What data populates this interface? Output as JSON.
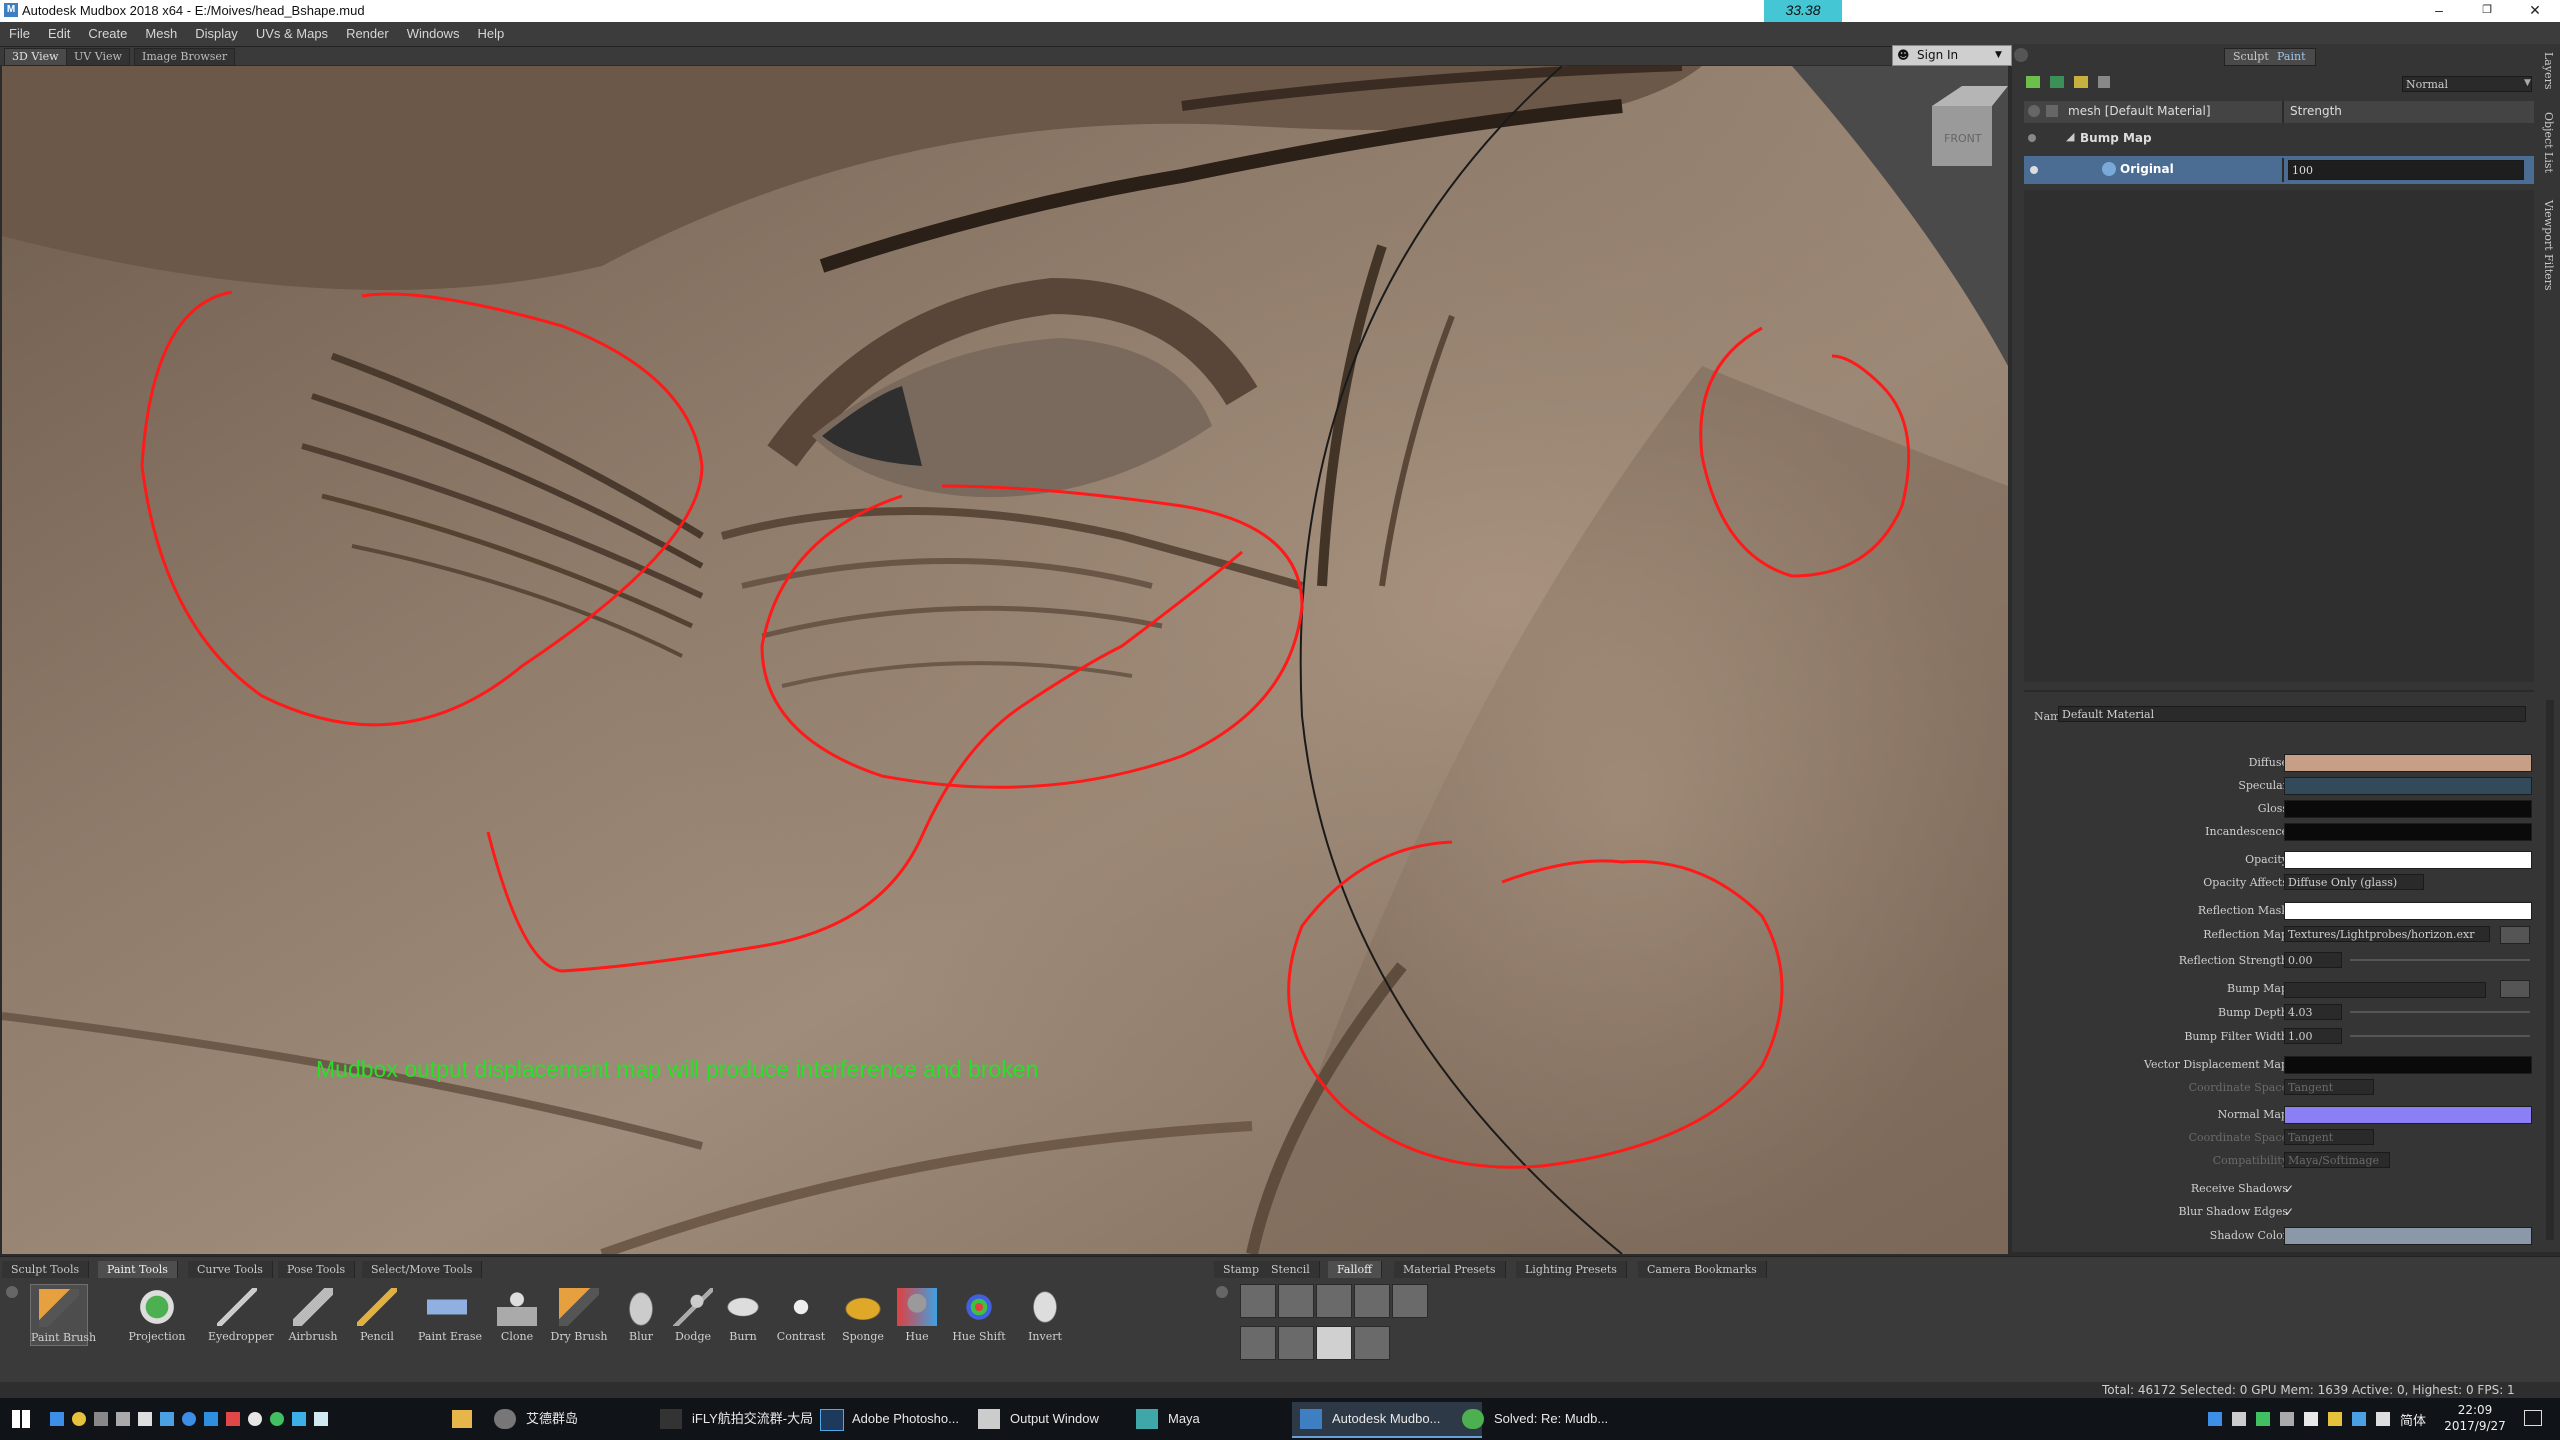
{
  "window": {
    "title": "Autodesk Mudbox 2018 x64 - E:/Moives/head_Bshape.mud",
    "fps_readout": "33.38",
    "minimize": "–",
    "restore": "❐",
    "close": "✕"
  },
  "menu": [
    "File",
    "Edit",
    "Create",
    "Mesh",
    "Display",
    "UVs & Maps",
    "Render",
    "Windows",
    "Help"
  ],
  "view_tabs": [
    "3D View",
    "UV View",
    "Image Browser"
  ],
  "signin": "Sign In",
  "viewcube_label": "FRONT",
  "annotation_text": "Mudbox output displacement map will produce interference and broken",
  "colors": {
    "annotation_red": "#ff1a1a",
    "annotation_green": "#28e028",
    "diffuse": "#c79f86",
    "specular": "#334a5a",
    "normal_map": "#8a7ff5",
    "shadow_color": "#8a98a8",
    "skin": "#7e6a5a"
  },
  "right_panel": {
    "mode_tabs": [
      "Sculpt",
      "Paint"
    ],
    "blend_mode": "Normal",
    "layer_header": {
      "name": "mesh [Default Material]",
      "strength": "Strength"
    },
    "group": "Bump Map",
    "layer": {
      "name": "Original",
      "value": "100"
    },
    "side_tabs": [
      "Layers",
      "Object List",
      "Viewport Filters"
    ],
    "material_name_label": "Name",
    "material_name": "Default Material",
    "props": {
      "diffuse": "Diffuse",
      "specular": "Specular",
      "gloss": "Gloss",
      "incandescence": "Incandescence",
      "opacity": "Opacity",
      "opacity_affects": "Opacity Affects",
      "opacity_affects_value": "Diffuse Only (glass)",
      "reflection_mask": "Reflection Mask",
      "reflection_map": "Reflection Map",
      "reflection_map_value": "Textures/Lightprobes/horizon.exr",
      "reflection_strength": "Reflection Strength",
      "reflection_strength_value": "0.00",
      "bump_map": "Bump Map",
      "bump_depth": "Bump Depth",
      "bump_depth_value": "4.03",
      "bump_filter_width": "Bump Filter Width",
      "bump_filter_width_value": "1.00",
      "vector_displacement_map": "Vector Displacement Map",
      "coordinate_space": "Coordinate Space",
      "coordinate_space_value": "Tangent",
      "normal_map": "Normal Map",
      "coordinate_space2": "Coordinate Space",
      "coordinate_space2_value": "Tangent",
      "compatibility": "Compatibility",
      "compatibility_value": "Maya/Softimage",
      "receive_shadows": "Receive Shadows",
      "blur_shadow_edges": "Blur Shadow Edges",
      "shadow_color": "Shadow Color"
    }
  },
  "tool_tabs": [
    "Sculpt Tools",
    "Paint Tools",
    "Curve Tools",
    "Pose Tools",
    "Select/Move Tools"
  ],
  "tray_tabs": [
    "Stamp",
    "Stencil",
    "Falloff",
    "Material Presets",
    "Lighting Presets",
    "Camera Bookmarks"
  ],
  "paint_tools": [
    "Paint Brush",
    "Projection",
    "Eyedropper",
    "Airbrush",
    "Pencil",
    "Paint Erase",
    "Clone",
    "Dry Brush",
    "Blur",
    "Dodge",
    "Burn",
    "Contrast",
    "Sponge",
    "Hue",
    "Hue Shift",
    "Invert"
  ],
  "status": "Total: 46172  Selected: 0 GPU Mem: 1639  Active: 0, Highest: 0  FPS: 1",
  "taskbar": {
    "apps": [
      "艾德群岛",
      "iFLY航拍交流群-大局",
      "Adobe Photosho...",
      "Output Window",
      "Maya",
      "Autodesk Mudbo...",
      "Solved: Re: Mudb..."
    ],
    "time": "22:09",
    "date": "2017/9/27",
    "ime": "简体"
  }
}
